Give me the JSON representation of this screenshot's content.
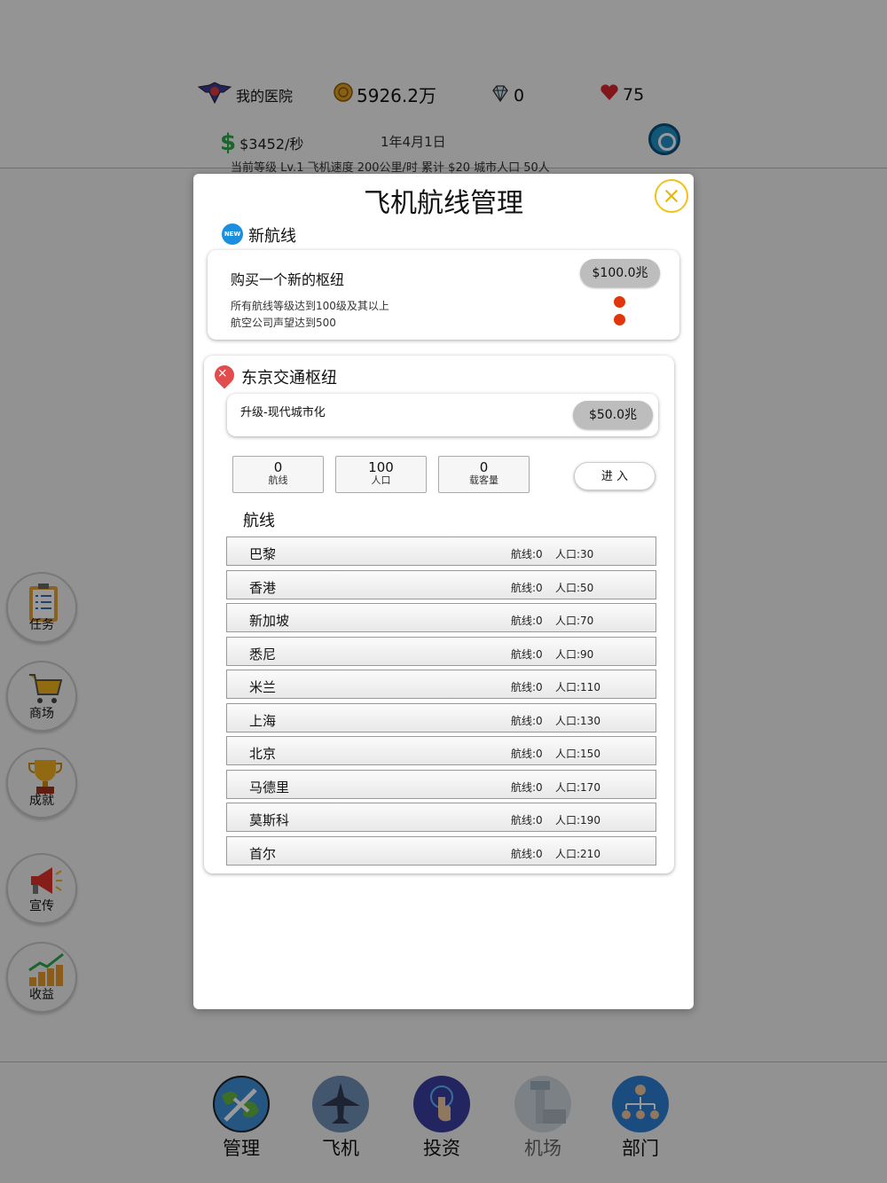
{
  "header": {
    "hospital_label": "我的医院",
    "coins": "5926.2万",
    "diamonds": "0",
    "hearts": "75",
    "income": "$3452/秒",
    "date": "1年4月1日",
    "subinfo": "当前等级 Lv.1  飞机速度 200公里/时  累计 $20  城市人口 50人"
  },
  "sidebar": [
    {
      "label": "任务",
      "icon": "clipboard-icon"
    },
    {
      "label": "商场",
      "icon": "cart-icon"
    },
    {
      "label": "成就",
      "icon": "trophy-icon"
    },
    {
      "label": "宣传",
      "icon": "megaphone-icon"
    },
    {
      "label": "收益",
      "icon": "growth-chart-icon"
    }
  ],
  "bottom_tabs": [
    {
      "label": "管理",
      "icon": "globe-plane-icon"
    },
    {
      "label": "飞机",
      "icon": "airplane-icon"
    },
    {
      "label": "投资",
      "icon": "touch-icon"
    },
    {
      "label": "机场",
      "icon": "airport-tower-icon"
    },
    {
      "label": "部门",
      "icon": "org-chart-icon"
    }
  ],
  "modal": {
    "title": "飞机航线管理",
    "new_badge": "NEW",
    "new_routes_title": "新航线",
    "hub_buy": {
      "title": "购买一个新的枢纽",
      "price": "$100.0兆",
      "requirements": [
        "所有航线等级达到100级及其以上",
        "航空公司声望达到500"
      ]
    },
    "hub": {
      "name": "东京交通枢纽",
      "upgrade_label": "升级-现代城市化",
      "upgrade_price": "$50.0兆",
      "stats": [
        {
          "value": "0",
          "label": "航线"
        },
        {
          "value": "100",
          "label": "人口"
        },
        {
          "value": "0",
          "label": "载客量"
        }
      ],
      "enter_label": "进 入",
      "routes_heading": "航线",
      "routes": [
        {
          "name": "巴黎",
          "routes": "航线:0",
          "population": "人口:30"
        },
        {
          "name": "香港",
          "routes": "航线:0",
          "population": "人口:50"
        },
        {
          "name": "新加坡",
          "routes": "航线:0",
          "population": "人口:70"
        },
        {
          "name": "悉尼",
          "routes": "航线:0",
          "population": "人口:90"
        },
        {
          "name": "米兰",
          "routes": "航线:0",
          "population": "人口:110"
        },
        {
          "name": "上海",
          "routes": "航线:0",
          "population": "人口:130"
        },
        {
          "name": "北京",
          "routes": "航线:0",
          "population": "人口:150"
        },
        {
          "name": "马德里",
          "routes": "航线:0",
          "population": "人口:170"
        },
        {
          "name": "莫斯科",
          "routes": "航线:0",
          "population": "人口:190"
        },
        {
          "name": "首尔",
          "routes": "航线:0",
          "population": "人口:210"
        }
      ]
    }
  }
}
